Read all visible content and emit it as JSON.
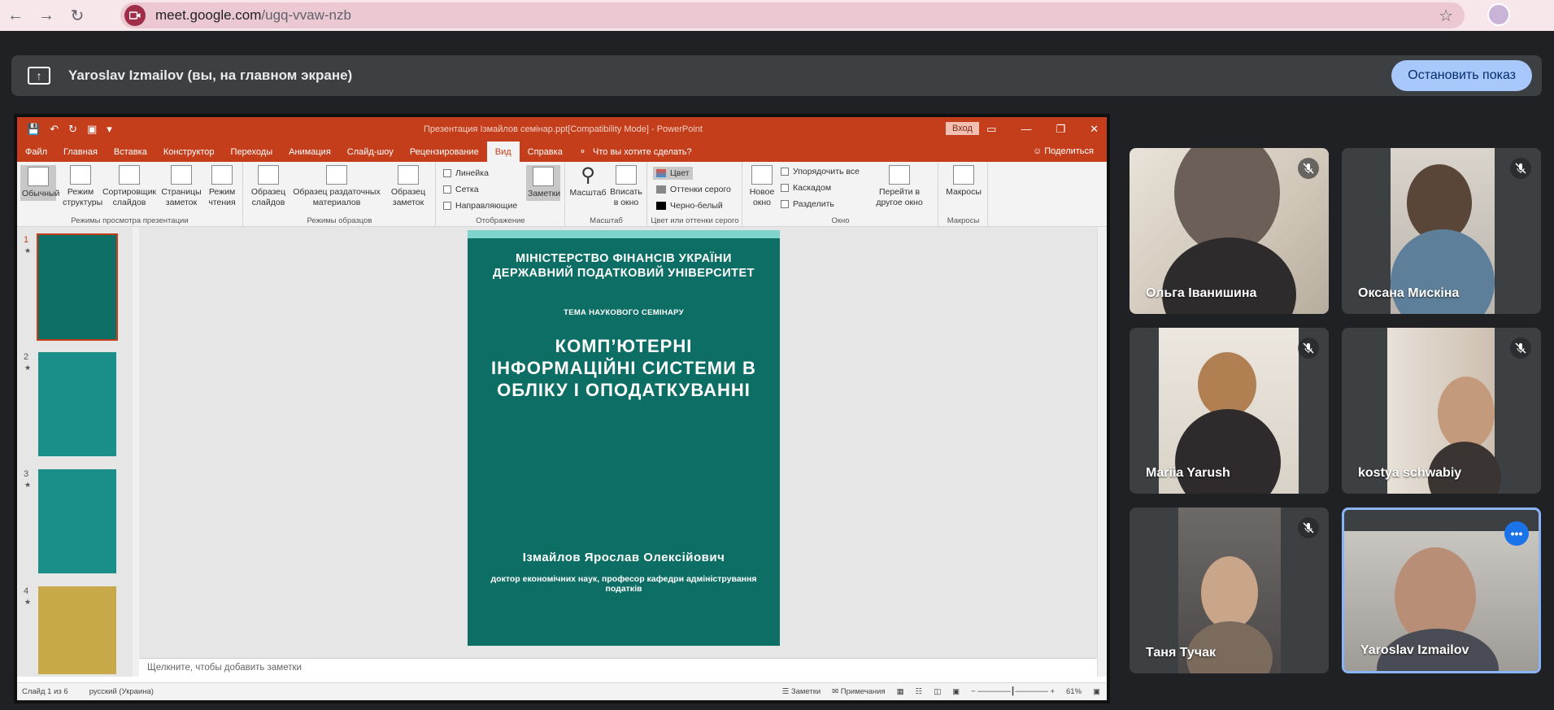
{
  "browser": {
    "url_host": "meet.google.com",
    "url_path": "/ugq-vvaw-nzb",
    "back_icon": "arrow-left-icon",
    "forward_icon": "arrow-right-icon",
    "reload_icon": "reload-icon",
    "bookmark_icon": "star-icon"
  },
  "banner": {
    "text": "Yaroslav Izmailov (вы, на главном экране)",
    "stop_label": "Остановить показ"
  },
  "powerpoint": {
    "title": "Презентация Ізмайлов семінар.ppt[Compatibility Mode]  -  PowerPoint",
    "signin": "Вход",
    "tabs": [
      "Файл",
      "Главная",
      "Вставка",
      "Конструктор",
      "Переходы",
      "Анимация",
      "Слайд-шоу",
      "Рецензирование",
      "Вид",
      "Справка"
    ],
    "active_tab": "Вид",
    "tell_me": "Что вы хотите сделать?",
    "share": "Поделиться",
    "ribbon": {
      "view_modes": [
        "Обычный",
        "Режим структуры",
        "Сортировщик слайдов",
        "Страницы заметок",
        "Режим чтения"
      ],
      "view_modes_label": "Режимы просмотра презентации",
      "masters": [
        "Образец слайдов",
        "Образец раздаточных материалов",
        "Образец заметок"
      ],
      "masters_label": "Режимы образцов",
      "show": [
        "Линейка",
        "Сетка",
        "Направляющие"
      ],
      "notes": "Заметки",
      "show_label": "Отображение",
      "zoom": [
        "Масштаб",
        "Вписать в окно"
      ],
      "zoom_label": "Масштаб",
      "color": [
        "Цвет",
        "Оттенки серого",
        "Черно-белый"
      ],
      "color_label": "Цвет или оттенки серого",
      "window": [
        "Новое окно",
        "Упорядочить все",
        "Каскадом",
        "Разделить",
        "Перейти в другое окно"
      ],
      "window_label": "Окно",
      "macros": "Макросы",
      "macros_label": "Макросы"
    },
    "slide": {
      "ministry_line1": "МІНІСТЕРСТВО ФІНАНСІВ УКРАЇНИ",
      "ministry_line2": "ДЕРЖАВНИЙ ПОДАТКОВИЙ УНІВЕРСИТЕТ",
      "topic_label": "ТЕМА НАУКОВОГО СЕМІНАРУ",
      "title_line1": "КОМП’ЮТЕРНІ",
      "title_line2": "ІНФОРМАЦІЙНІ СИСТЕМИ В",
      "title_line3": "ОБЛІКУ І ОПОДАТКУВАННІ",
      "author": "Ізмайлов Ярослав Олексійович",
      "degree": "доктор економічних наук, професор кафедри адміністрування податків"
    },
    "thumb_numbers": [
      "1",
      "2",
      "3",
      "4"
    ],
    "notes_placeholder": "Щелкните, чтобы добавить заметки",
    "status": {
      "slide": "Слайд 1 из 6",
      "language": "русский (Украина)",
      "notes": "Заметки",
      "comments": "Примечания",
      "zoom": "61%"
    }
  },
  "participants": [
    {
      "name": "Ольга Іванишина",
      "muted": true
    },
    {
      "name": "Оксана Мискіна",
      "muted": true
    },
    {
      "name": "Mariia Yarush",
      "muted": true
    },
    {
      "name": "kostya schwabiy",
      "muted": true
    },
    {
      "name": "Таня Тучак",
      "muted": true
    },
    {
      "name": "Yaroslav Izmailov",
      "muted": false,
      "active_speaker": true
    }
  ],
  "colors": {
    "meet_bg": "#202124",
    "pp_accent": "#c43e1c",
    "slide_bg": "#0d6e66",
    "stop_button": "#a8c7fa"
  }
}
